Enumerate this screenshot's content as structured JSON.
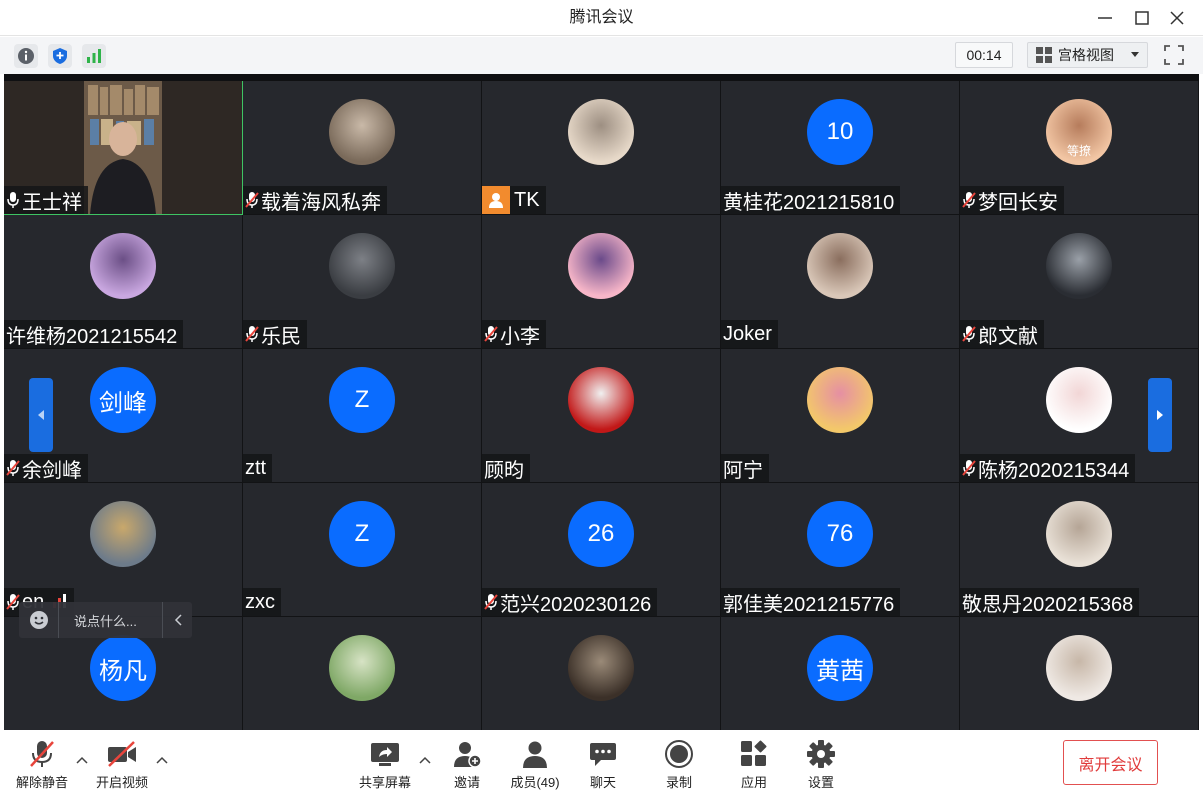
{
  "window": {
    "title": "腾讯会议"
  },
  "topbar": {
    "timer": "00:14",
    "view_mode": "宫格视图"
  },
  "participants": [
    {
      "name": "王士祥",
      "mic": "on",
      "avatar": "video",
      "active": true
    },
    {
      "name": "载着海风私奔",
      "mic": "muted",
      "avatar": "photo"
    },
    {
      "name": "TK",
      "mic": "none",
      "avatar": "photo",
      "host_badge": true
    },
    {
      "name": "黄桂花2021215810",
      "mic": "none",
      "avatar": "text",
      "avatar_text": "10"
    },
    {
      "name": "梦回长安",
      "mic": "muted",
      "avatar": "photo",
      "status": "等撩"
    },
    {
      "name": "许维杨2021215542",
      "mic": "none",
      "avatar": "photo"
    },
    {
      "name": "乐民",
      "mic": "muted",
      "avatar": "photo"
    },
    {
      "name": "小李",
      "mic": "muted",
      "avatar": "photo"
    },
    {
      "name": "Joker",
      "mic": "none",
      "avatar": "photo"
    },
    {
      "name": "郎文献",
      "mic": "muted",
      "avatar": "photo"
    },
    {
      "name": "余剑峰",
      "mic": "muted",
      "avatar": "text",
      "avatar_text": "剑峰"
    },
    {
      "name": "ztt",
      "mic": "none",
      "avatar": "text",
      "avatar_text": "Z"
    },
    {
      "name": "顾昀",
      "mic": "none",
      "avatar": "photo"
    },
    {
      "name": "阿宁",
      "mic": "none",
      "avatar": "photo"
    },
    {
      "name": "陈杨2020215344",
      "mic": "muted",
      "avatar": "photo"
    },
    {
      "name": "en",
      "mic": "muted",
      "avatar": "photo",
      "signal": true
    },
    {
      "name": "zxc",
      "mic": "none",
      "avatar": "text",
      "avatar_text": "Z"
    },
    {
      "name": "范兴2020230126",
      "mic": "muted",
      "avatar": "text",
      "avatar_text": "26"
    },
    {
      "name": "郭佳美2021215776",
      "mic": "none",
      "avatar": "text",
      "avatar_text": "76"
    },
    {
      "name": "敬思丹2020215368",
      "mic": "none",
      "avatar": "photo"
    },
    {
      "name": "",
      "mic": "muted",
      "avatar": "text",
      "avatar_text": "杨凡"
    },
    {
      "name": "",
      "mic": "none",
      "avatar": "photo"
    },
    {
      "name": "",
      "mic": "none",
      "avatar": "photo"
    },
    {
      "name": "",
      "mic": "none",
      "avatar": "text",
      "avatar_text": "黄茜"
    },
    {
      "name": "",
      "mic": "none",
      "avatar": "photo"
    }
  ],
  "chat_input": {
    "placeholder": "说点什么..."
  },
  "toolbar": {
    "unmute_label": "解除静音",
    "start_video_label": "开启视频",
    "share_label": "共享屏幕",
    "invite_label": "邀请",
    "members_label": "成员(49)",
    "chat_label": "聊天",
    "record_label": "录制",
    "apps_label": "应用",
    "settings_label": "设置",
    "leave_label": "离开会议"
  },
  "colors": {
    "avatar_blue": "#0a6cff",
    "tile_bg": "#26282d",
    "active_border": "#3ec463",
    "leave_red": "#e03a3a",
    "mute_red": "#e8453c"
  }
}
